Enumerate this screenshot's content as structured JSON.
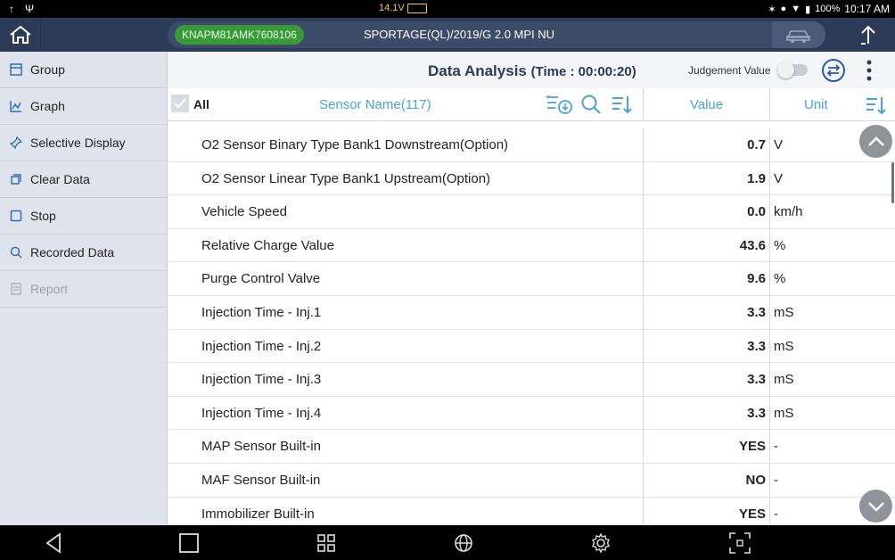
{
  "status_bar": {
    "voltage": "14.1V",
    "battery_percent": "100%",
    "time": "10:17 AM"
  },
  "top_bar": {
    "vin": "KNAPM81AMK7608106",
    "vehicle": "SPORTAGE(QL)/2019/G 2.0 MPI NU"
  },
  "sidebar": {
    "items": [
      {
        "label": "Group",
        "icon": "group-icon",
        "enabled": true
      },
      {
        "label": "Graph",
        "icon": "graph-icon",
        "enabled": true
      },
      {
        "label": "Selective Display",
        "icon": "pin-icon",
        "enabled": true
      },
      {
        "label": "Clear Data",
        "icon": "clear-icon",
        "enabled": true
      },
      {
        "label": "Stop",
        "icon": "stop-icon",
        "enabled": true
      },
      {
        "label": "Recorded Data",
        "icon": "search-record-icon",
        "enabled": true
      },
      {
        "label": "Report",
        "icon": "report-icon",
        "enabled": false
      }
    ]
  },
  "header": {
    "title": "Data Analysis",
    "time_label": "(Time : 00:00:20)",
    "judgement_label": "Judgement Value",
    "judgement_on": false
  },
  "columns": {
    "all_label": "All",
    "sensor_name": "Sensor Name(117)",
    "value": "Value",
    "unit": "Unit"
  },
  "rows": [
    {
      "name": "O2 Sensor Binary Type Bank1 Downstream(Option)",
      "value": "0.7",
      "unit": "V"
    },
    {
      "name": "O2 Sensor Linear Type Bank1 Upstream(Option)",
      "value": "1.9",
      "unit": "V"
    },
    {
      "name": "Vehicle Speed",
      "value": "0.0",
      "unit": "km/h"
    },
    {
      "name": "Relative Charge Value",
      "value": "43.6",
      "unit": "%"
    },
    {
      "name": "Purge Control Valve",
      "value": "9.6",
      "unit": "%"
    },
    {
      "name": "Injection Time - Inj.1",
      "value": "3.3",
      "unit": "mS"
    },
    {
      "name": "Injection Time - Inj.2",
      "value": "3.3",
      "unit": "mS"
    },
    {
      "name": "Injection Time - Inj.3",
      "value": "3.3",
      "unit": "mS"
    },
    {
      "name": "Injection Time - Inj.4",
      "value": "3.3",
      "unit": "mS"
    },
    {
      "name": "MAP Sensor Built-in",
      "value": "YES",
      "unit": "-"
    },
    {
      "name": "MAF Sensor Built-in",
      "value": "NO",
      "unit": "-"
    },
    {
      "name": "Immobilizer Built-in",
      "value": "YES",
      "unit": "-"
    }
  ],
  "colors": {
    "top_bar": "#2c3b57",
    "vin_badge": "#3a9a3a",
    "accent_blue": "#4aa3d8",
    "sidebar_bg": "#dfe4ec"
  }
}
